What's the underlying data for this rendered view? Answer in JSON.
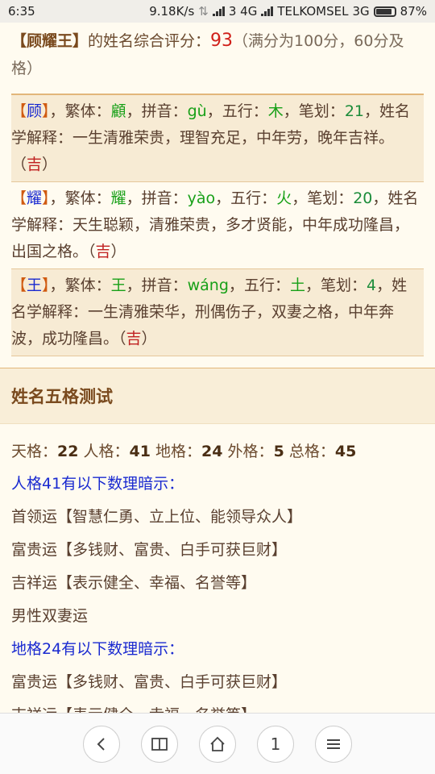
{
  "status_bar": {
    "time": "6:35",
    "speed": "9.18K/s",
    "sim1_label": "3 4G",
    "carrier": "TELKOMSEL",
    "network": "3G",
    "battery": "87%",
    "battery_level": 0.87
  },
  "score": {
    "name": "【顾耀王】",
    "text": "的姓名综合评分：",
    "value": "93",
    "note": "（满分为100分，60分及格）"
  },
  "chars": [
    {
      "char": "顾",
      "fanti_label": "繁体：",
      "fanti": "顧",
      "pinyin_label": "拼音：",
      "pinyin": "gù",
      "wuxing_label": "五行：",
      "wuxing": "木",
      "bihua_label": "笔划：",
      "bihua": "21",
      "explain": "姓名学解释：一生清雅荣贵，理智充足，中年劳，晚年吉祥。（",
      "ji": "吉",
      "close": "）"
    },
    {
      "char": "耀",
      "fanti_label": "繁体：",
      "fanti": "耀",
      "pinyin_label": "拼音：",
      "pinyin": "yào",
      "wuxing_label": "五行：",
      "wuxing": "火",
      "bihua_label": "笔划：",
      "bihua": "20",
      "explain": "姓名学解释：天生聪颖，清雅荣贵，多才贤能，中年成功隆昌，出国之格。（",
      "ji": "吉",
      "close": "）"
    },
    {
      "char": "王",
      "fanti_label": "繁体：",
      "fanti": "王",
      "pinyin_label": "拼音：",
      "pinyin": "wáng",
      "wuxing_label": "五行：",
      "wuxing": "土",
      "bihua_label": "笔划：",
      "bihua": "4",
      "explain": "姓名学解释：一生清雅荣华，刑偶伤子，双妻之格，中年奔波，成功隆昌。（",
      "ji": "吉",
      "close": "）"
    }
  ],
  "section": {
    "title": "姓名五格测试"
  },
  "wuge": {
    "tian_label": "天格：",
    "tian": "22",
    "ren_label": "人格：",
    "ren": "41",
    "di_label": "地格：",
    "di": "24",
    "wai_label": "外格：",
    "wai": "5",
    "zong_label": "总格：",
    "zong": "45"
  },
  "hints": {
    "ren_title": "人格41有以下数理暗示：",
    "ren_items": [
      "首领运【智慧仁勇、立上位、能领导众人】",
      "富贵运【多钱财、富贵、白手可获巨财】",
      "吉祥运【表示健全、幸福、名誉等】",
      "男性双妻运"
    ],
    "di_title": "地格24有以下数理暗示：",
    "di_items": [
      "富贵运【多钱财、富贵、白手可获巨财】",
      "吉祥运【表示健全、幸福、名誉等】"
    ]
  },
  "bottom_nav": {
    "back_icon": "chevron-left-icon",
    "book_icon": "book-icon",
    "home_icon": "home-icon",
    "tabs_count": "1",
    "menu_icon": "menu-icon"
  }
}
